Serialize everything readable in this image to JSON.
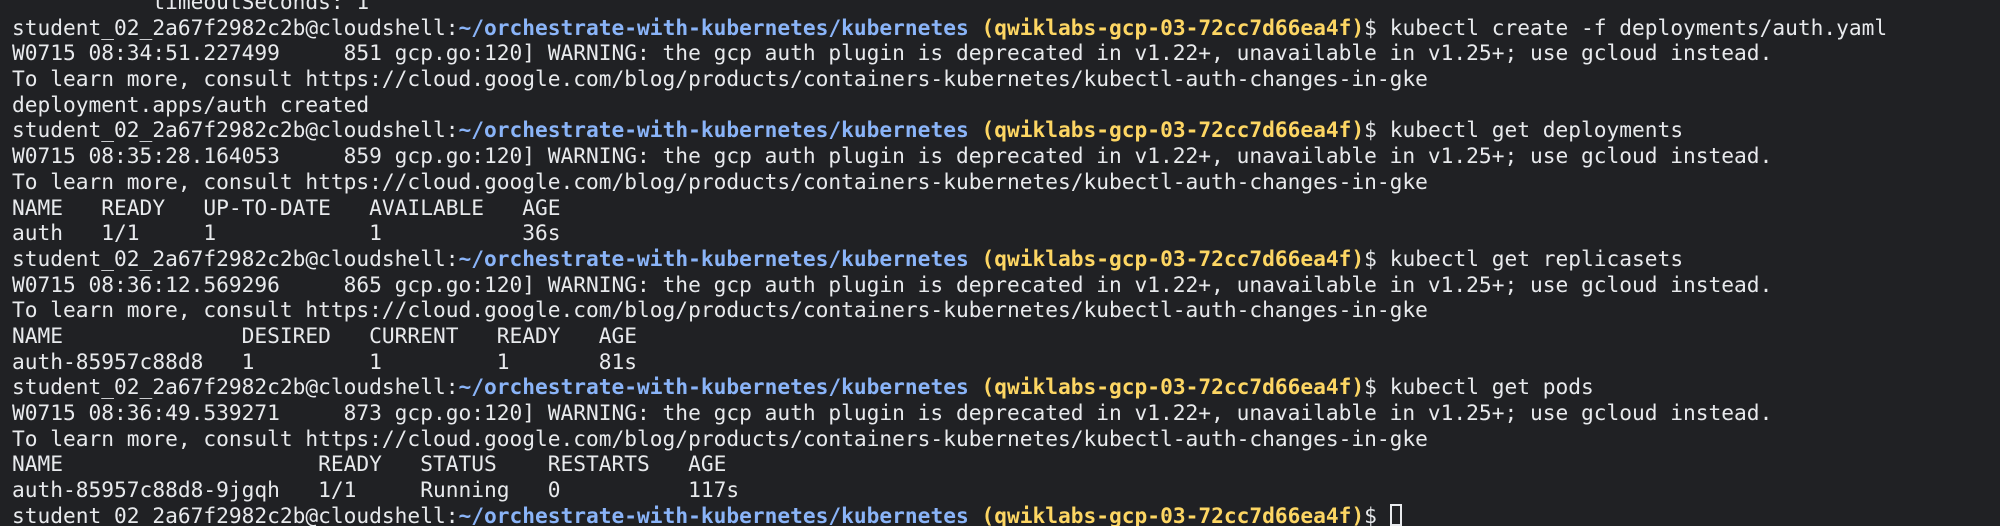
{
  "terminal": {
    "prompt": {
      "user": "student_02_2a67f2982c2b@cloudshell:",
      "path": "~/orchestrate-with-kubernetes/kubernetes",
      "project": "(qwiklabs-gcp-03-72cc7d66ea4f)",
      "symbol": "$ "
    },
    "lines": [
      {
        "type": "out",
        "text": "           timeoutSeconds: 1"
      },
      {
        "type": "cmd",
        "text": "kubectl create -f deployments/auth.yaml"
      },
      {
        "type": "out",
        "text": "W0715 08:34:51.227499     851 gcp.go:120] WARNING: the gcp auth plugin is deprecated in v1.22+, unavailable in v1.25+; use gcloud instead."
      },
      {
        "type": "out",
        "text": "To learn more, consult https://cloud.google.com/blog/products/containers-kubernetes/kubectl-auth-changes-in-gke"
      },
      {
        "type": "out",
        "text": "deployment.apps/auth created"
      },
      {
        "type": "cmd",
        "text": "kubectl get deployments"
      },
      {
        "type": "out",
        "text": "W0715 08:35:28.164053     859 gcp.go:120] WARNING: the gcp auth plugin is deprecated in v1.22+, unavailable in v1.25+; use gcloud instead."
      },
      {
        "type": "out",
        "text": "To learn more, consult https://cloud.google.com/blog/products/containers-kubernetes/kubectl-auth-changes-in-gke"
      },
      {
        "type": "out",
        "text": "NAME   READY   UP-TO-DATE   AVAILABLE   AGE"
      },
      {
        "type": "out",
        "text": "auth   1/1     1            1           36s"
      },
      {
        "type": "cmd",
        "text": "kubectl get replicasets"
      },
      {
        "type": "out",
        "text": "W0715 08:36:12.569296     865 gcp.go:120] WARNING: the gcp auth plugin is deprecated in v1.22+, unavailable in v1.25+; use gcloud instead."
      },
      {
        "type": "out",
        "text": "To learn more, consult https://cloud.google.com/blog/products/containers-kubernetes/kubectl-auth-changes-in-gke"
      },
      {
        "type": "out",
        "text": "NAME              DESIRED   CURRENT   READY   AGE"
      },
      {
        "type": "out",
        "text": "auth-85957c88d8   1         1         1       81s"
      },
      {
        "type": "cmd",
        "text": "kubectl get pods"
      },
      {
        "type": "out",
        "text": "W0715 08:36:49.539271     873 gcp.go:120] WARNING: the gcp auth plugin is deprecated in v1.22+, unavailable in v1.25+; use gcloud instead."
      },
      {
        "type": "out",
        "text": "To learn more, consult https://cloud.google.com/blog/products/containers-kubernetes/kubectl-auth-changes-in-gke"
      },
      {
        "type": "out",
        "text": "NAME                    READY   STATUS    RESTARTS   AGE"
      },
      {
        "type": "out",
        "text": "auth-85957c88d8-9jgqh   1/1     Running   0          117s"
      },
      {
        "type": "cmd",
        "text": "",
        "cursor": true
      }
    ]
  },
  "colors": {
    "background": "#202124",
    "text": "#e8eaed",
    "path": "#8ab4f8",
    "project": "#fdd663"
  }
}
